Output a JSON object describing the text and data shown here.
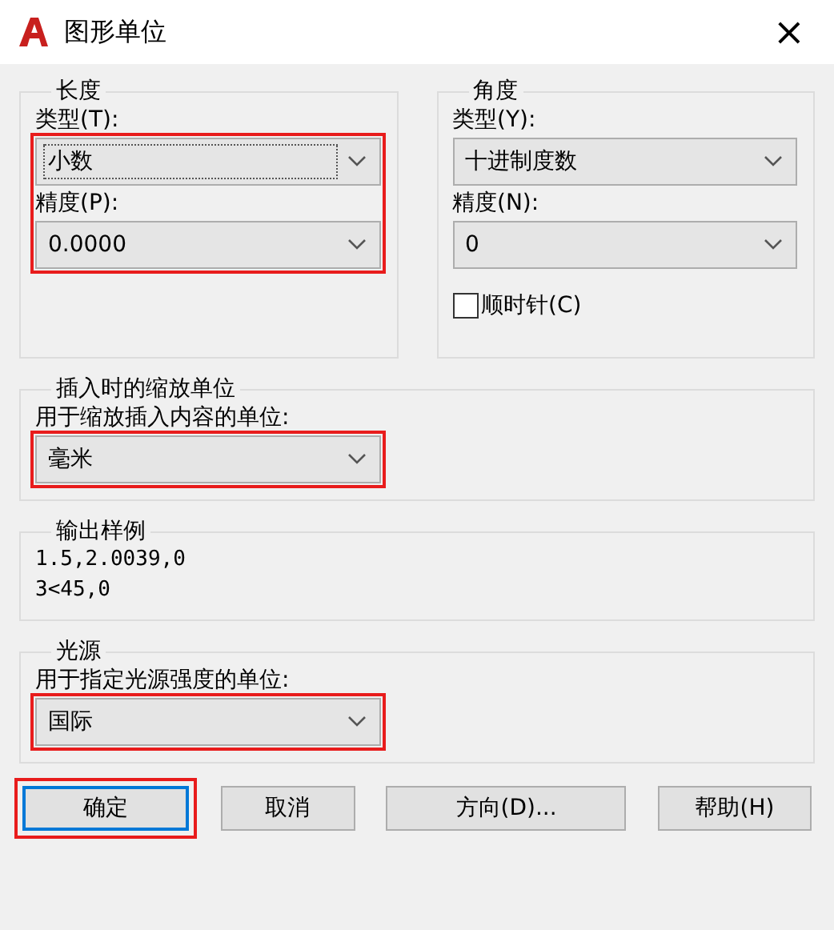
{
  "window": {
    "title": "图形单位",
    "close": "×"
  },
  "length": {
    "legend": "长度",
    "highlighted": true,
    "type_label": "类型(T):",
    "type_value": "小数",
    "type_focused": true,
    "precision_label": "精度(P):",
    "precision_value": "0.0000"
  },
  "angle": {
    "legend": "角度",
    "type_label": "类型(Y):",
    "type_value": "十进制度数",
    "precision_label": "精度(N):",
    "precision_value": "0",
    "clockwise": {
      "label": "顺时针(C)",
      "checked": false
    }
  },
  "insertion": {
    "legend": "插入时的缩放单位",
    "label": "用于缩放插入内容的单位:",
    "value": "毫米",
    "highlighted": true
  },
  "sample": {
    "legend": "输出样例",
    "lines": [
      "1.5,2.0039,0",
      "3<45,0"
    ]
  },
  "lighting": {
    "legend": "光源",
    "label": "用于指定光源强度的单位:",
    "value": "国际",
    "highlighted": true
  },
  "buttons": [
    {
      "label": "确定",
      "default": true,
      "highlighted": true
    },
    {
      "label": "取消",
      "default": false,
      "highlighted": false
    },
    {
      "label": "方向(D)...",
      "default": false,
      "highlighted": false
    },
    {
      "label": "帮助(H)",
      "default": false,
      "highlighted": false
    }
  ]
}
